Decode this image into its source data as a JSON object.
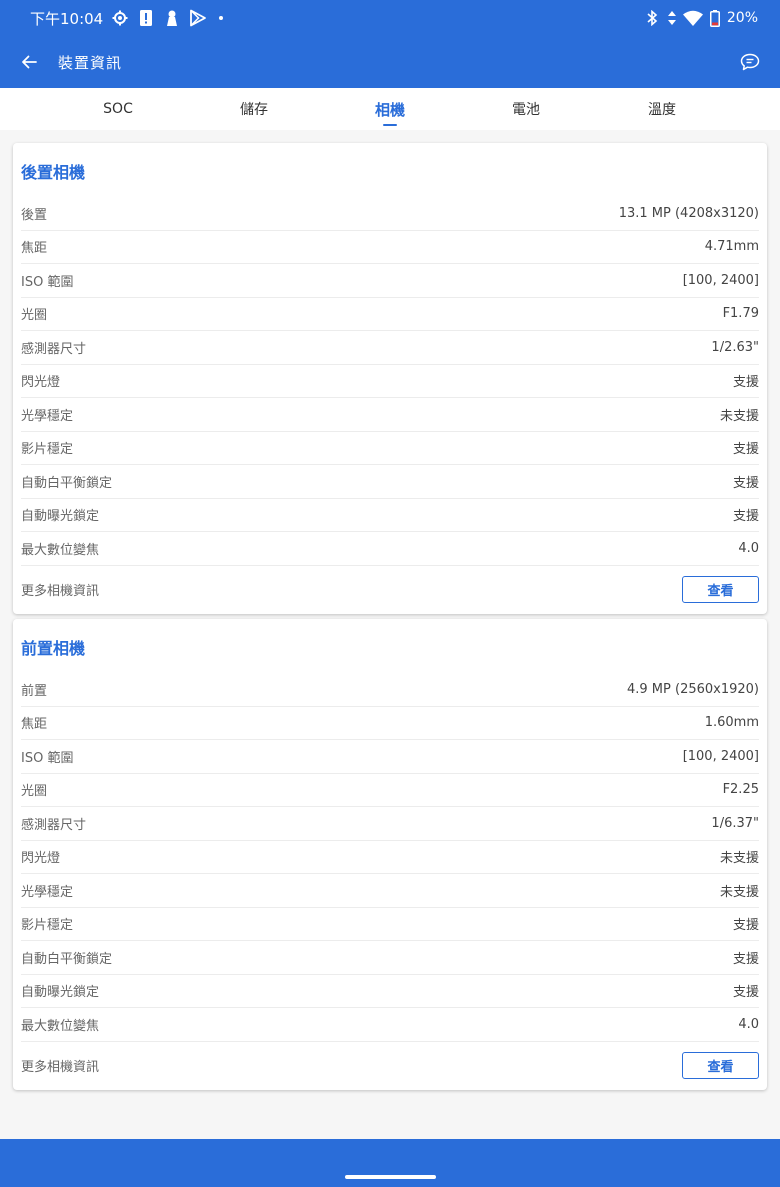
{
  "status_bar": {
    "time": "下午10:04",
    "battery": "20%",
    "icons": [
      "settings-gear-icon",
      "alert-icon",
      "key-icon",
      "play-store-icon",
      "notification-dot-icon",
      "bluetooth-icon",
      "data-arrows-icon",
      "wifi-icon",
      "battery-icon"
    ]
  },
  "app_bar": {
    "title": "裝置資訊",
    "icons": [
      "back-arrow-icon",
      "chat-bubble-icon"
    ]
  },
  "tabs": [
    {
      "label": "SOC",
      "active": false
    },
    {
      "label": "儲存",
      "active": false
    },
    {
      "label": "相機",
      "active": true
    },
    {
      "label": "電池",
      "active": false
    },
    {
      "label": "溫度",
      "active": false
    }
  ],
  "rear_camera": {
    "title": "後置相機",
    "rows": [
      {
        "label": "後置",
        "value": "13.1 MP (4208x3120)"
      },
      {
        "label": "焦距",
        "value": "4.71mm"
      },
      {
        "label": "ISO 範圍",
        "value": "[100, 2400]"
      },
      {
        "label": "光圈",
        "value": "F1.79"
      },
      {
        "label": "感測器尺寸",
        "value": "1/2.63\""
      },
      {
        "label": "閃光燈",
        "value": "支援"
      },
      {
        "label": "光學穩定",
        "value": "未支援"
      },
      {
        "label": "影片穩定",
        "value": "支援"
      },
      {
        "label": "自動白平衡鎖定",
        "value": "支援"
      },
      {
        "label": "自動曝光鎖定",
        "value": "支援"
      },
      {
        "label": "最大數位變焦",
        "value": "4.0"
      }
    ],
    "more_label": "更多相機資訊",
    "view_button": "查看"
  },
  "front_camera": {
    "title": "前置相機",
    "rows": [
      {
        "label": "前置",
        "value": "4.9 MP (2560x1920)"
      },
      {
        "label": "焦距",
        "value": "1.60mm"
      },
      {
        "label": "ISO 範圍",
        "value": "[100, 2400]"
      },
      {
        "label": "光圈",
        "value": "F2.25"
      },
      {
        "label": "感測器尺寸",
        "value": "1/6.37\""
      },
      {
        "label": "閃光燈",
        "value": "未支援"
      },
      {
        "label": "光學穩定",
        "value": "未支援"
      },
      {
        "label": "影片穩定",
        "value": "支援"
      },
      {
        "label": "自動白平衡鎖定",
        "value": "支援"
      },
      {
        "label": "自動曝光鎖定",
        "value": "支援"
      },
      {
        "label": "最大數位變焦",
        "value": "4.0"
      }
    ],
    "more_label": "更多相機資訊",
    "view_button": "查看"
  },
  "colors": {
    "accent": "#2a6dd9",
    "background": "#f6f6f6",
    "card": "#ffffff"
  }
}
